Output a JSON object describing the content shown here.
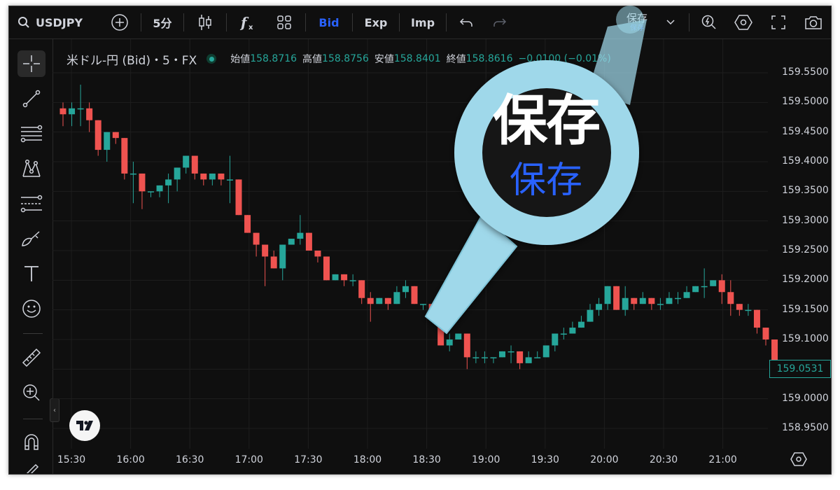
{
  "toolbar": {
    "symbol": "USDJPY",
    "interval": "5分",
    "bid": "Bid",
    "exp": "Exp",
    "imp": "Imp",
    "save_label": "保存",
    "save_sub": "保存"
  },
  "legend": {
    "title": "米ドル-円 (Bid)・5・FX",
    "open_label": "始値",
    "open": "158.8716",
    "high_label": "高値",
    "high": "158.8756",
    "low_label": "安値",
    "low": "158.8401",
    "close_label": "終値",
    "close": "158.8616",
    "change": "−0.0100 (−0.01%)"
  },
  "price_axis": [
    "159.5500",
    "159.5000",
    "159.4500",
    "159.4000",
    "159.3500",
    "159.3000",
    "159.2500",
    "159.2000",
    "159.1500",
    "159.1000",
    "159.0500",
    "159.0000",
    "158.9500"
  ],
  "current_price": "159.0531",
  "time_axis": [
    "15:30",
    "16:00",
    "16:30",
    "17:00",
    "17:30",
    "18:00",
    "18:30",
    "19:00",
    "19:30",
    "20:00",
    "20:30",
    "21:00"
  ],
  "magnifier": {
    "big": "保存",
    "small": "保存"
  },
  "colors": {
    "up": "#26a69a",
    "down": "#ef5350",
    "accent": "#2962ff",
    "magnifier": "#9fd8ea"
  },
  "chart_data": {
    "type": "candlestick",
    "title": "米ドル-円 (Bid)・5・FX",
    "ylim": [
      158.93,
      159.57
    ],
    "candles": [
      {
        "o": 159.49,
        "h": 159.5,
        "c": 159.48,
        "l": 159.46
      },
      {
        "o": 159.48,
        "h": 159.5,
        "c": 159.49,
        "l": 159.46
      },
      {
        "o": 159.49,
        "h": 159.53,
        "c": 159.49,
        "l": 159.46
      },
      {
        "o": 159.49,
        "h": 159.5,
        "c": 159.47,
        "l": 159.45
      },
      {
        "o": 159.47,
        "h": 159.47,
        "c": 159.42,
        "l": 159.41
      },
      {
        "o": 159.42,
        "h": 159.45,
        "c": 159.45,
        "l": 159.4
      },
      {
        "o": 159.45,
        "h": 159.45,
        "c": 159.44,
        "l": 159.43
      },
      {
        "o": 159.44,
        "h": 159.44,
        "c": 159.38,
        "l": 159.37
      },
      {
        "o": 159.38,
        "h": 159.4,
        "c": 159.38,
        "l": 159.33
      },
      {
        "o": 159.38,
        "h": 159.38,
        "c": 159.35,
        "l": 159.32
      },
      {
        "o": 159.35,
        "h": 159.35,
        "c": 159.35,
        "l": 159.34
      },
      {
        "o": 159.35,
        "h": 159.36,
        "c": 159.36,
        "l": 159.34
      },
      {
        "o": 159.36,
        "h": 159.38,
        "c": 159.37,
        "l": 159.33
      },
      {
        "o": 159.37,
        "h": 159.39,
        "c": 159.39,
        "l": 159.35
      },
      {
        "o": 159.39,
        "h": 159.41,
        "c": 159.41,
        "l": 159.38
      },
      {
        "o": 159.41,
        "h": 159.41,
        "c": 159.38,
        "l": 159.37
      },
      {
        "o": 159.38,
        "h": 159.38,
        "c": 159.37,
        "l": 159.36
      },
      {
        "o": 159.37,
        "h": 159.38,
        "c": 159.38,
        "l": 159.36
      },
      {
        "o": 159.38,
        "h": 159.38,
        "c": 159.37,
        "l": 159.36
      },
      {
        "o": 159.37,
        "h": 159.41,
        "c": 159.37,
        "l": 159.33
      },
      {
        "o": 159.37,
        "h": 159.37,
        "c": 159.31,
        "l": 159.31
      },
      {
        "o": 159.31,
        "h": 159.31,
        "c": 159.28,
        "l": 159.28
      },
      {
        "o": 159.28,
        "h": 159.28,
        "c": 159.26,
        "l": 159.24
      },
      {
        "o": 159.26,
        "h": 159.26,
        "c": 159.24,
        "l": 159.19
      },
      {
        "o": 159.24,
        "h": 159.25,
        "c": 159.22,
        "l": 159.22
      },
      {
        "o": 159.22,
        "h": 159.26,
        "c": 159.26,
        "l": 159.2
      },
      {
        "o": 159.26,
        "h": 159.27,
        "c": 159.27,
        "l": 159.26
      },
      {
        "o": 159.27,
        "h": 159.31,
        "c": 159.28,
        "l": 159.26
      },
      {
        "o": 159.28,
        "h": 159.28,
        "c": 159.25,
        "l": 159.25
      },
      {
        "o": 159.25,
        "h": 159.25,
        "c": 159.24,
        "l": 159.23
      },
      {
        "o": 159.24,
        "h": 159.24,
        "c": 159.2,
        "l": 159.2
      },
      {
        "o": 159.2,
        "h": 159.21,
        "c": 159.21,
        "l": 159.2
      },
      {
        "o": 159.21,
        "h": 159.21,
        "c": 159.2,
        "l": 159.19
      },
      {
        "o": 159.2,
        "h": 159.21,
        "c": 159.2,
        "l": 159.19
      },
      {
        "o": 159.2,
        "h": 159.2,
        "c": 159.17,
        "l": 159.16
      },
      {
        "o": 159.17,
        "h": 159.18,
        "c": 159.16,
        "l": 159.13
      },
      {
        "o": 159.16,
        "h": 159.17,
        "c": 159.17,
        "l": 159.16
      },
      {
        "o": 159.17,
        "h": 159.17,
        "c": 159.16,
        "l": 159.15
      },
      {
        "o": 159.16,
        "h": 159.19,
        "c": 159.18,
        "l": 159.16
      },
      {
        "o": 159.18,
        "h": 159.2,
        "c": 159.19,
        "l": 159.17
      },
      {
        "o": 159.19,
        "h": 159.19,
        "c": 159.16,
        "l": 159.16
      },
      {
        "o": 159.16,
        "h": 159.16,
        "c": 159.16,
        "l": 159.15
      },
      {
        "o": 159.16,
        "h": 159.16,
        "c": 159.15,
        "l": 159.14
      },
      {
        "o": 159.15,
        "h": 159.15,
        "c": 159.09,
        "l": 159.09
      },
      {
        "o": 159.09,
        "h": 159.11,
        "c": 159.1,
        "l": 159.08
      },
      {
        "o": 159.1,
        "h": 159.11,
        "c": 159.11,
        "l": 159.1
      },
      {
        "o": 159.11,
        "h": 159.11,
        "c": 159.07,
        "l": 159.05
      },
      {
        "o": 159.07,
        "h": 159.08,
        "c": 159.07,
        "l": 159.06
      },
      {
        "o": 159.07,
        "h": 159.08,
        "c": 159.07,
        "l": 159.06
      },
      {
        "o": 159.07,
        "h": 159.07,
        "c": 159.07,
        "l": 159.06
      },
      {
        "o": 159.07,
        "h": 159.08,
        "c": 159.08,
        "l": 159.07
      },
      {
        "o": 159.08,
        "h": 159.09,
        "c": 159.08,
        "l": 159.06
      },
      {
        "o": 159.08,
        "h": 159.08,
        "c": 159.06,
        "l": 159.05
      },
      {
        "o": 159.06,
        "h": 159.08,
        "c": 159.07,
        "l": 159.06
      },
      {
        "o": 159.07,
        "h": 159.08,
        "c": 159.07,
        "l": 159.07
      },
      {
        "o": 159.07,
        "h": 159.09,
        "c": 159.09,
        "l": 159.07
      },
      {
        "o": 159.09,
        "h": 159.11,
        "c": 159.11,
        "l": 159.08
      },
      {
        "o": 159.11,
        "h": 159.12,
        "c": 159.11,
        "l": 159.1
      },
      {
        "o": 159.11,
        "h": 159.13,
        "c": 159.12,
        "l": 159.11
      },
      {
        "o": 159.12,
        "h": 159.14,
        "c": 159.13,
        "l": 159.12
      },
      {
        "o": 159.13,
        "h": 159.16,
        "c": 159.15,
        "l": 159.13
      },
      {
        "o": 159.15,
        "h": 159.17,
        "c": 159.16,
        "l": 159.14
      },
      {
        "o": 159.16,
        "h": 159.19,
        "c": 159.19,
        "l": 159.15
      },
      {
        "o": 159.19,
        "h": 159.19,
        "c": 159.15,
        "l": 159.15
      },
      {
        "o": 159.15,
        "h": 159.19,
        "c": 159.17,
        "l": 159.14
      },
      {
        "o": 159.17,
        "h": 159.17,
        "c": 159.16,
        "l": 159.15
      },
      {
        "o": 159.16,
        "h": 159.18,
        "c": 159.17,
        "l": 159.16
      },
      {
        "o": 159.17,
        "h": 159.17,
        "c": 159.16,
        "l": 159.15
      },
      {
        "o": 159.16,
        "h": 159.17,
        "c": 159.16,
        "l": 159.15
      },
      {
        "o": 159.16,
        "h": 159.18,
        "c": 159.17,
        "l": 159.16
      },
      {
        "o": 159.17,
        "h": 159.18,
        "c": 159.17,
        "l": 159.16
      },
      {
        "o": 159.17,
        "h": 159.19,
        "c": 159.18,
        "l": 159.17
      },
      {
        "o": 159.18,
        "h": 159.19,
        "c": 159.19,
        "l": 159.18
      },
      {
        "o": 159.19,
        "h": 159.22,
        "c": 159.19,
        "l": 159.17
      },
      {
        "o": 159.19,
        "h": 159.2,
        "c": 159.2,
        "l": 159.19
      },
      {
        "o": 159.2,
        "h": 159.21,
        "c": 159.18,
        "l": 159.16
      },
      {
        "o": 159.18,
        "h": 159.2,
        "c": 159.16,
        "l": 159.14
      },
      {
        "o": 159.16,
        "h": 159.16,
        "c": 159.15,
        "l": 159.14
      },
      {
        "o": 159.15,
        "h": 159.16,
        "c": 159.15,
        "l": 159.14
      },
      {
        "o": 159.15,
        "h": 159.15,
        "c": 159.12,
        "l": 159.11
      },
      {
        "o": 159.12,
        "h": 159.12,
        "c": 159.1,
        "l": 159.09
      },
      {
        "o": 159.1,
        "h": 159.1,
        "c": 159.06,
        "l": 159.05
      }
    ]
  }
}
